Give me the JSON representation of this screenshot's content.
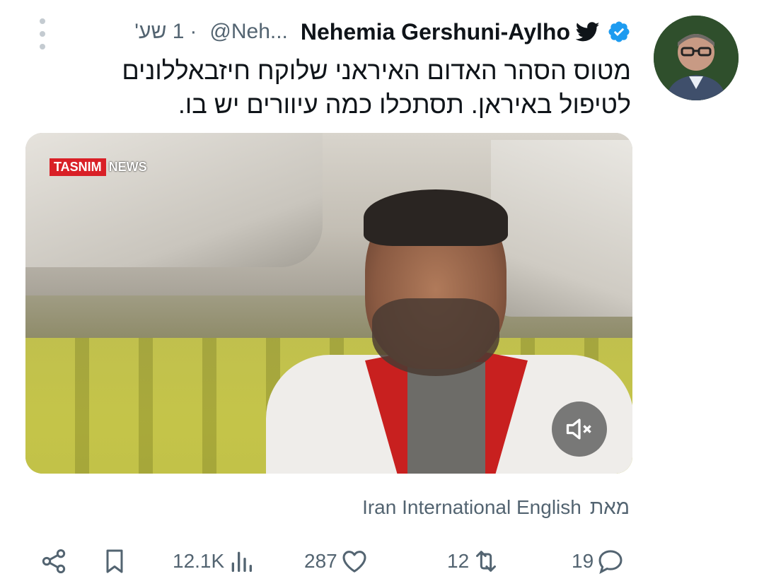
{
  "tweet": {
    "display_name": "Nehemia Gershuni-Aylho",
    "handle": "@Neh...",
    "separator": "·",
    "time": "1 שע'",
    "text": "מטוס הסהר האדום האיראני שלוקח חיזבאללונים לטיפול באיראן. תסתכלו כמה עיוורים יש בו."
  },
  "media": {
    "watermark_a": "TASNIM",
    "watermark_b": "NEWS"
  },
  "source": {
    "label": "מאת",
    "name": "Iran International English"
  },
  "actions": {
    "replies": "19",
    "retweets": "12",
    "likes": "287",
    "views": "12.1K"
  },
  "icons": {
    "verified": "verified-badge-icon",
    "brand": "twitter-bird-icon",
    "more": "more-vertical-icon",
    "reply": "reply-icon",
    "retweet": "retweet-icon",
    "like": "heart-icon",
    "views": "views-chart-icon",
    "bookmark": "bookmark-icon",
    "share": "share-icon",
    "mute": "volume-mute-icon"
  },
  "colors": {
    "verified": "#1d9bf0",
    "secondary_text": "#536471",
    "primary_text": "#0f1419",
    "tasnim_red": "#d92027"
  }
}
